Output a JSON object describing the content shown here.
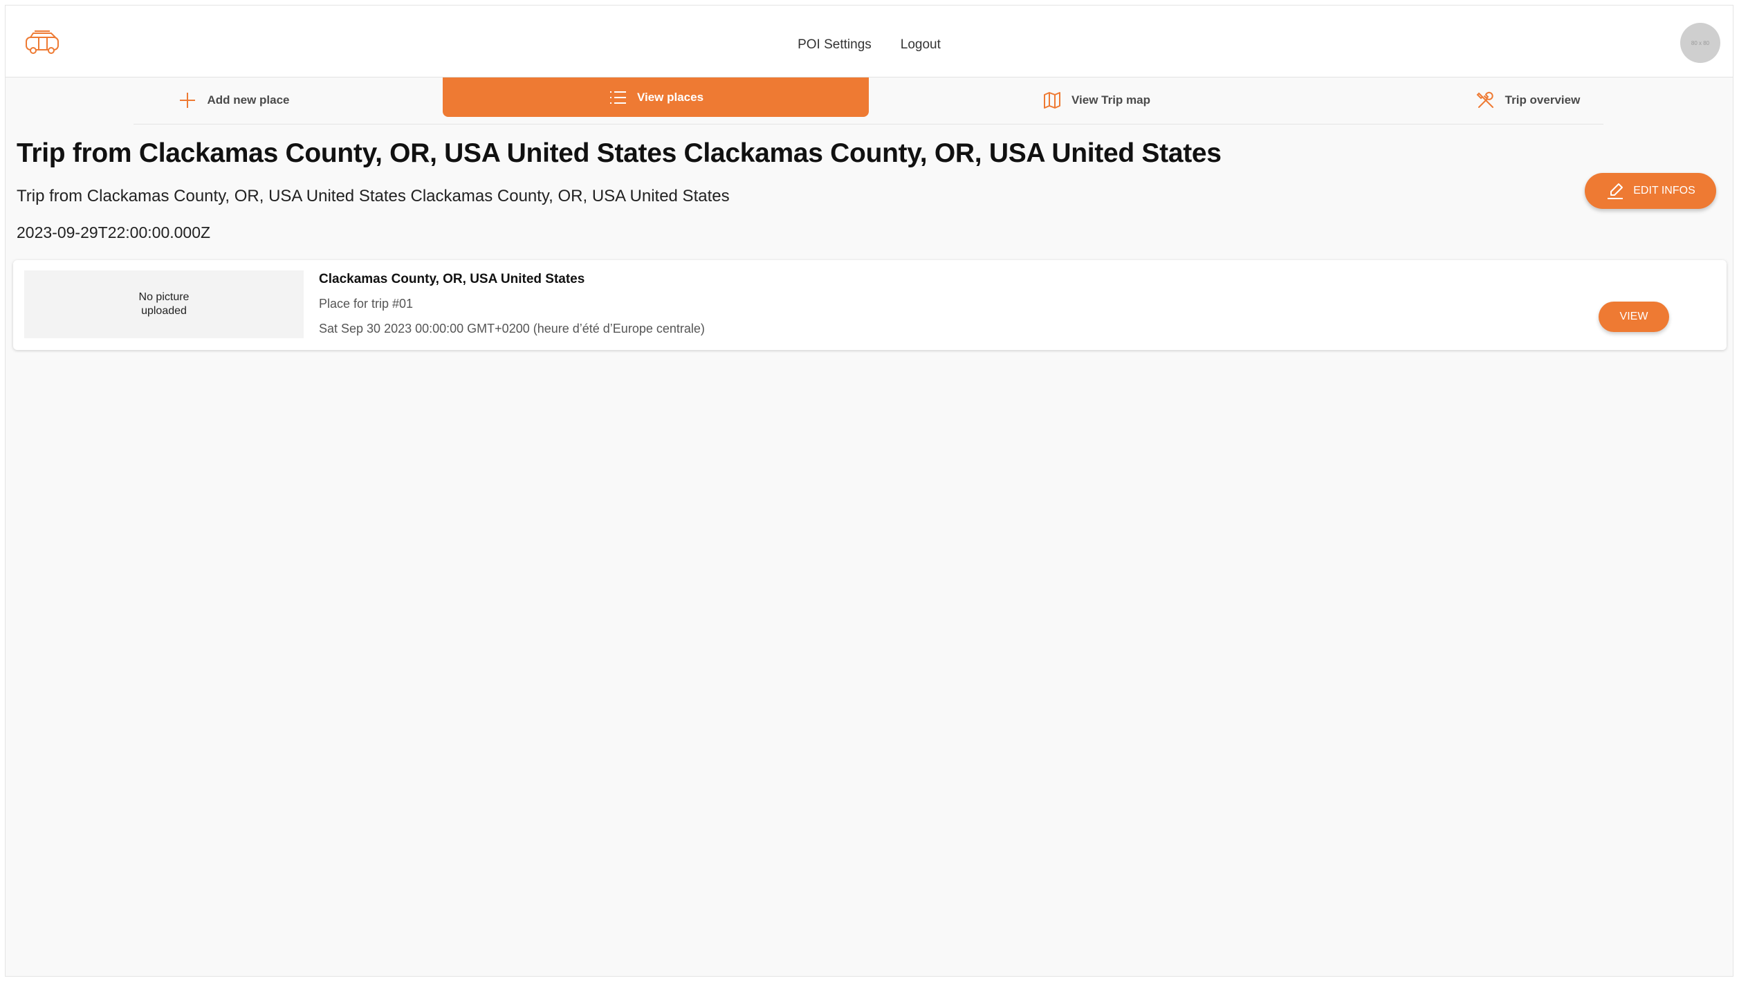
{
  "nav": {
    "links": [
      "POI Settings",
      "Logout"
    ],
    "avatar_text": "80 x 80"
  },
  "tabs": [
    {
      "label": "Add new place",
      "icon": "plus-icon",
      "active": false
    },
    {
      "label": "View places",
      "icon": "list-icon",
      "active": true
    },
    {
      "label": "View Trip map",
      "icon": "map-icon",
      "active": false
    },
    {
      "label": "Trip overview",
      "icon": "tools-icon",
      "active": false
    }
  ],
  "trip": {
    "title": "Trip from Clackamas County, OR, USA United States Clackamas County, OR, USA United States",
    "subtitle": "Trip from Clackamas County, OR, USA United States Clackamas County, OR, USA United States",
    "date": "2023-09-29T22:00:00.000Z",
    "edit_label": "EDIT INFOS"
  },
  "places": [
    {
      "no_picture": "No picture\nuploaded",
      "name": "Clackamas County, OR, USA United States",
      "description": "Place for trip #01",
      "date": "Sat Sep 30 2023 00:00:00 GMT+0200 (heure d’été d’Europe centrale)",
      "view_label": "VIEW"
    }
  ],
  "colors": {
    "accent": "#ee7a33",
    "background": "#f9f9f9"
  }
}
